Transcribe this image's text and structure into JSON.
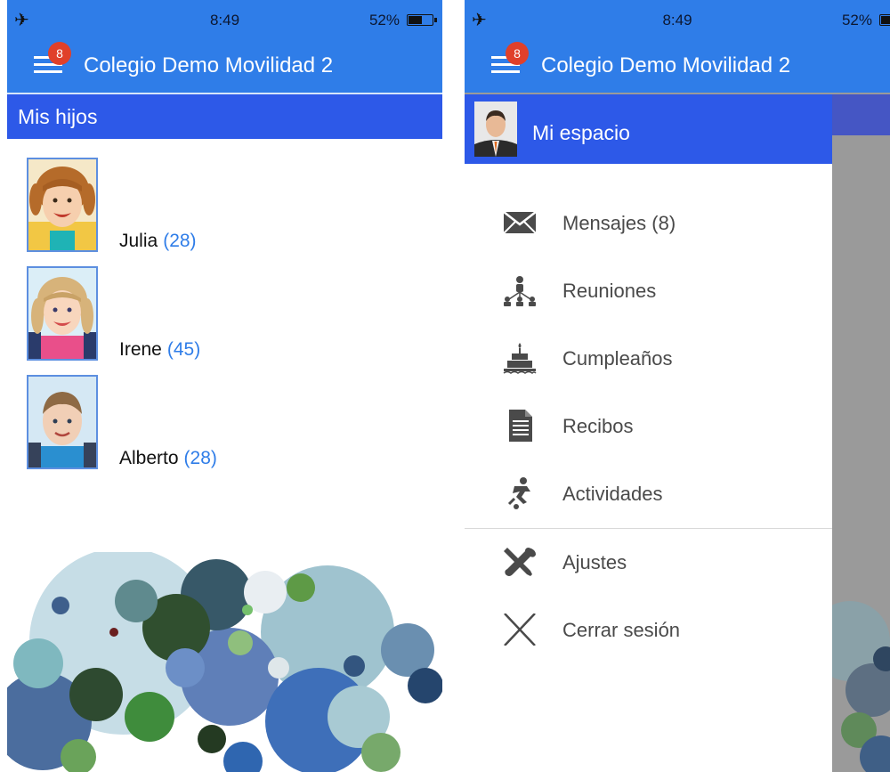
{
  "status": {
    "time": "8:49",
    "battery": "52%"
  },
  "app": {
    "title": "Colegio Demo Movilidad 2",
    "badge": "8"
  },
  "left": {
    "section": "Mis hijos",
    "children": [
      {
        "name": "Julia",
        "count": "(28)"
      },
      {
        "name": "Irene",
        "count": "(45)"
      },
      {
        "name": "Alberto",
        "count": "(28)"
      }
    ]
  },
  "drawer": {
    "header": "Mi espacio",
    "items": [
      {
        "label": "Mensajes (8)",
        "icon": "envelope-icon"
      },
      {
        "label": "Reuniones",
        "icon": "meeting-icon"
      },
      {
        "label": "Cumpleaños",
        "icon": "cake-icon"
      },
      {
        "label": "Recibos",
        "icon": "document-icon"
      },
      {
        "label": "Actividades",
        "icon": "activity-icon"
      },
      {
        "label": "Ajustes",
        "icon": "tools-icon"
      },
      {
        "label": "Cerrar sesión",
        "icon": "close-icon"
      }
    ]
  },
  "colors": {
    "header": "#2f7de8",
    "section": "#2d59e8",
    "badge": "#e0402a",
    "accent": "#2f7de8"
  }
}
